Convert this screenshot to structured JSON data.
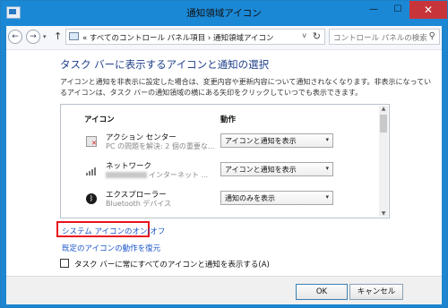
{
  "window": {
    "title": "通知領域アイコン",
    "close": "✕",
    "minimize": "—",
    "maximize": "☐"
  },
  "nav": {
    "back": "←",
    "forward": "→",
    "dropdown": "▾",
    "up": "↑",
    "address": "« すべてのコントロール パネル項目 › 通知領域アイコン",
    "address_dropdown": "v",
    "refresh": "↻",
    "search_placeholder": "コントロール パネルの検索",
    "search_icon": "⚲"
  },
  "main": {
    "heading": "タスク バーに表示するアイコンと通知の選択",
    "description": "アイコンと通知を非表示に設定した場合は、変更内容や更新内容について通知されなくなります。非表示になっているアイコンは、タスク バーの通知領域の横にある矢印をクリックしていつでも表示できます。",
    "table": {
      "col_icon": "アイコン",
      "col_action": "動作",
      "rows": [
        {
          "name": "アクション センター",
          "sub": "PC の問題を解決: 2 個の重要な...",
          "action": "アイコンと通知を表示",
          "icon": "action-center-flag-icon"
        },
        {
          "name": "ネットワーク",
          "sub": "インターネット ...",
          "action": "アイコンと通知を表示",
          "icon": "network-signal-icon"
        },
        {
          "name": "エクスプローラー",
          "sub": "Bluetooth デバイス",
          "action": "通知のみを表示",
          "icon": "bluetooth-icon"
        }
      ]
    },
    "link_system_icons": "システム アイコンのオン/オフ",
    "link_restore": "既定のアイコンの動作を復元",
    "checkbox_label": "タスク バーに常にすべてのアイコンと通知を表示する(A)",
    "checkbox_checked": false
  },
  "footer": {
    "ok": "OK",
    "cancel": "キャンセル"
  },
  "colors": {
    "accent": "#1b88d6",
    "highlight": "#e8121c",
    "link": "#1a55c8",
    "heading": "#1e3f8a"
  }
}
